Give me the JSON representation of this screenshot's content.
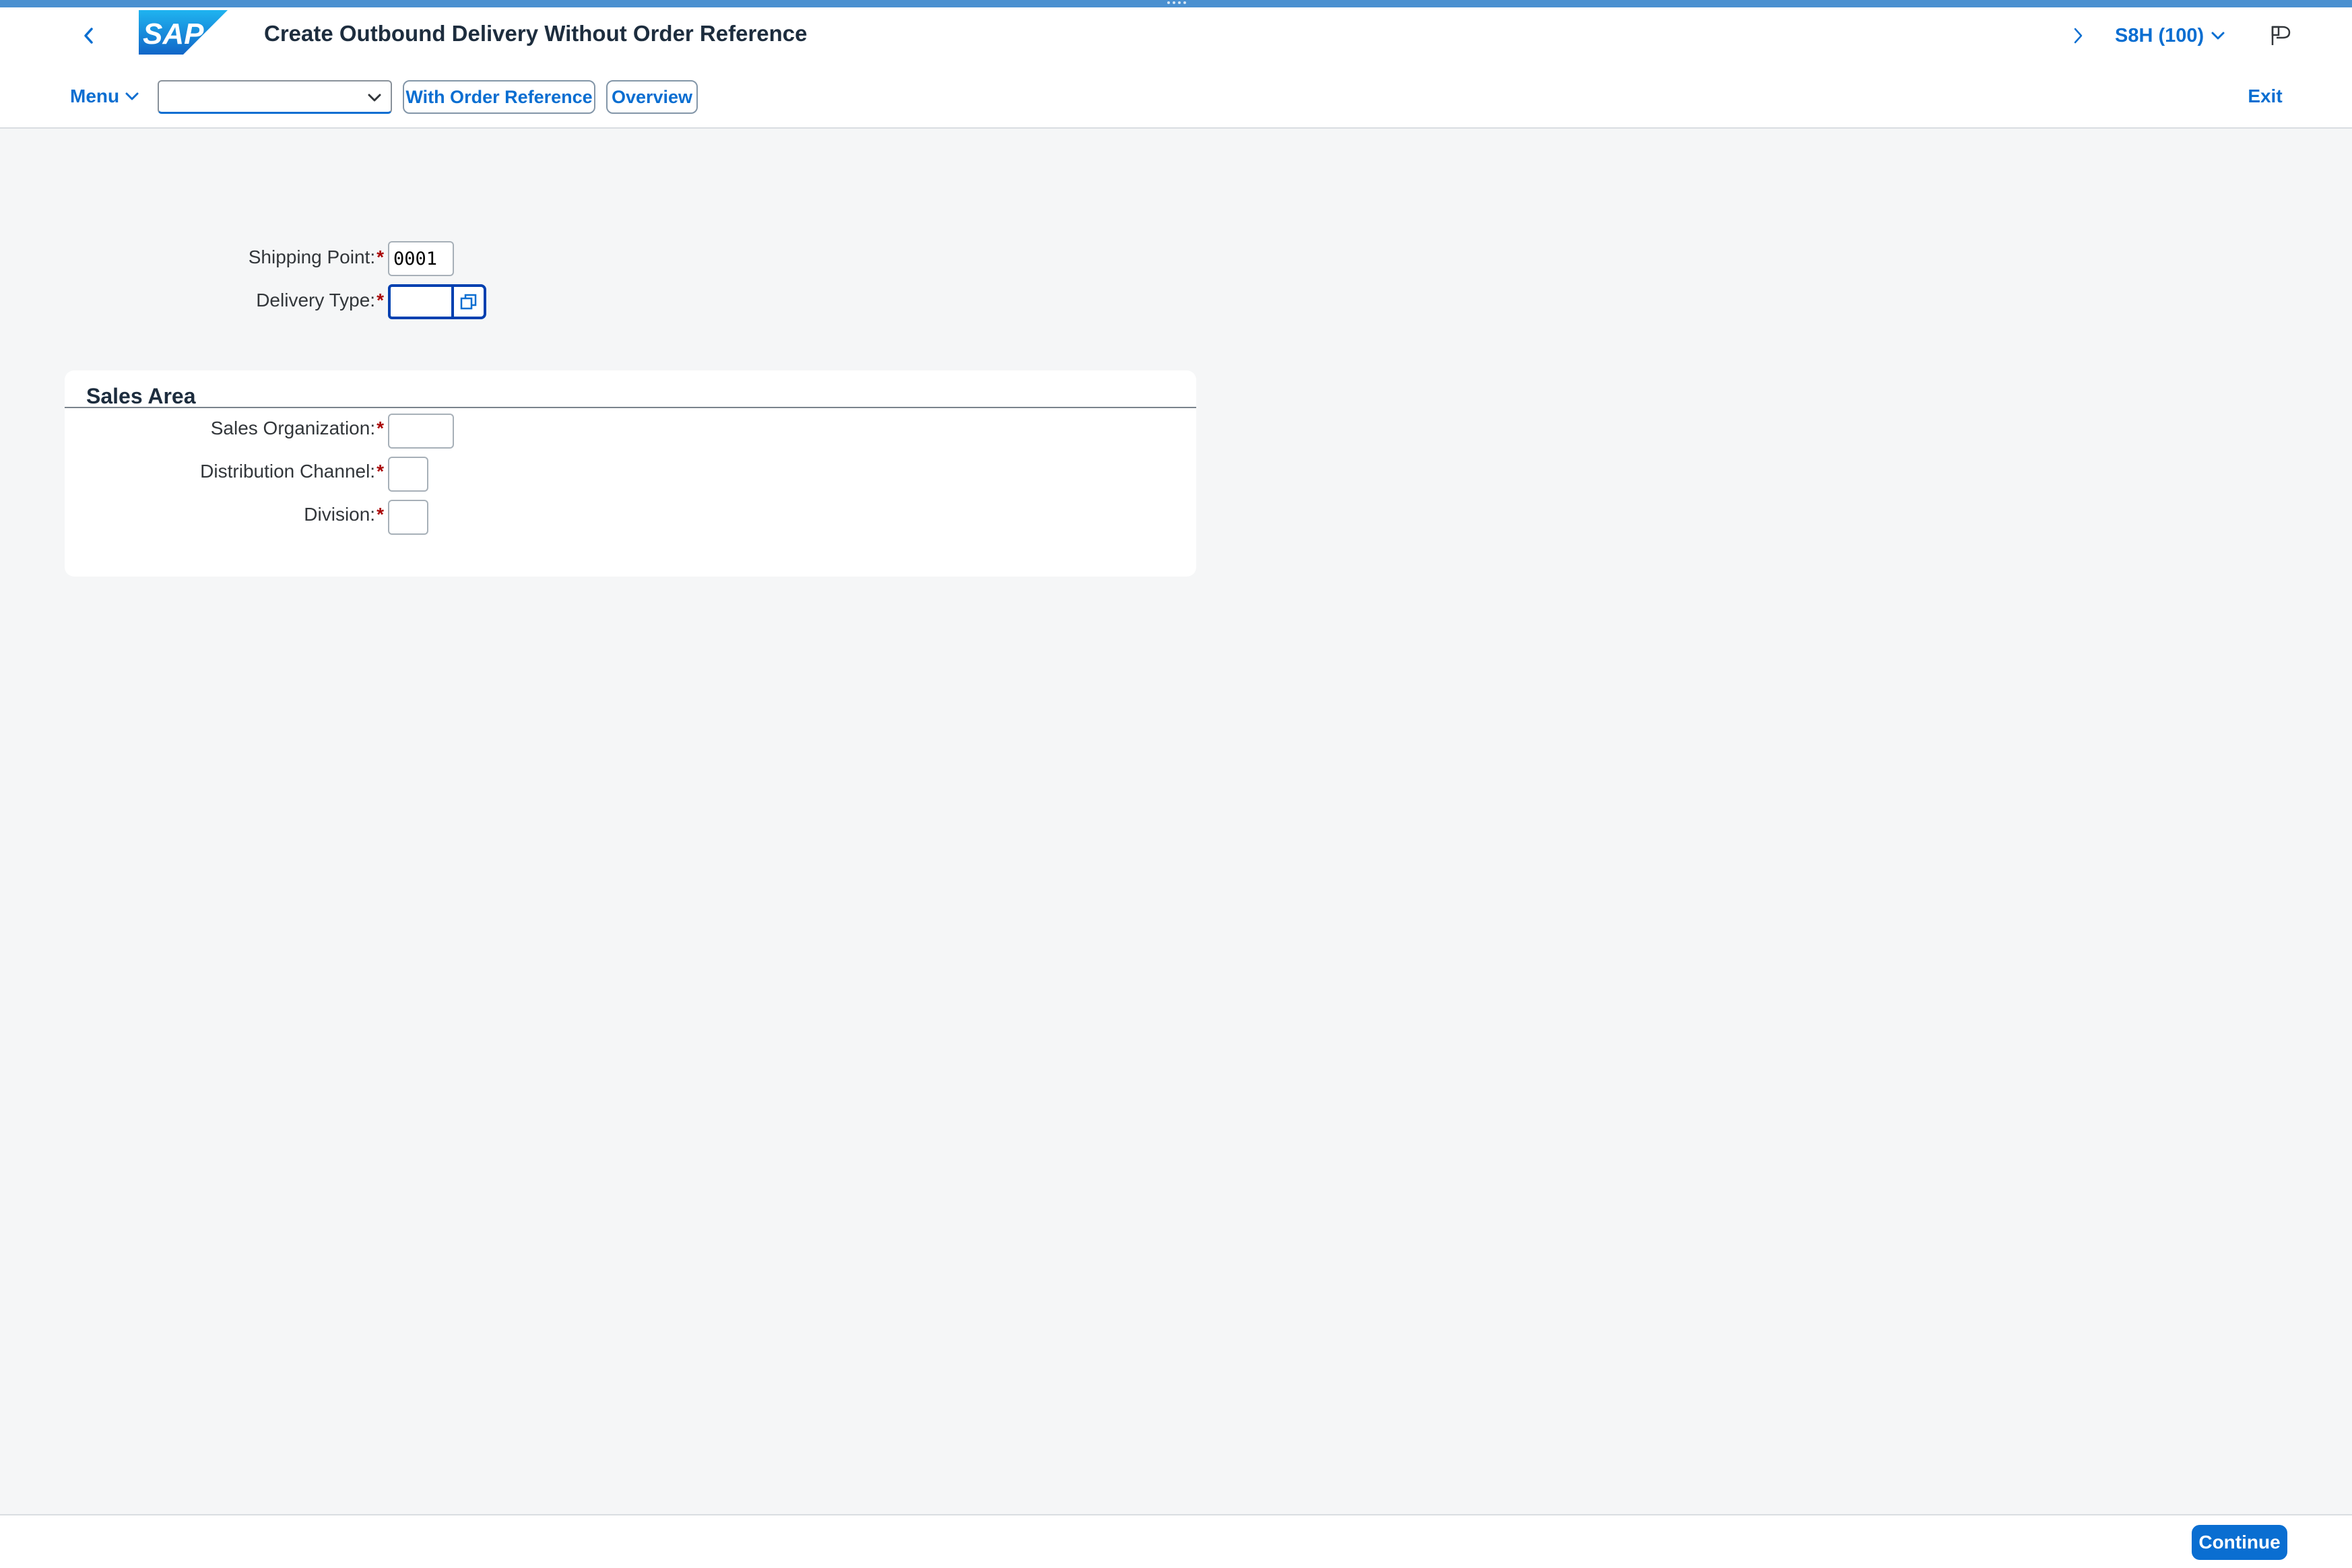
{
  "shell": {
    "title": "Create Outbound Delivery Without Order Reference",
    "system": "S8H (100)",
    "logo_text": "SAP"
  },
  "toolbar": {
    "menu_label": "Menu",
    "command_value": "",
    "with_order_reference_label": "With Order Reference",
    "overview_label": "Overview",
    "exit_label": "Exit"
  },
  "form": {
    "shipping_point": {
      "label": "Shipping Point:",
      "required": "*",
      "value": "0001"
    },
    "delivery_type": {
      "label": "Delivery Type:",
      "required": "*",
      "value": ""
    }
  },
  "sales_area": {
    "title": "Sales Area",
    "sales_organization": {
      "label": "Sales Organization:",
      "required": "*",
      "value": ""
    },
    "distribution_channel": {
      "label": "Distribution Channel:",
      "required": "*",
      "value": ""
    },
    "division": {
      "label": "Division:",
      "required": "*",
      "value": ""
    }
  },
  "footer": {
    "continue_label": "Continue"
  },
  "colors": {
    "accent": "#0a6ed1",
    "header_accent": "#4a90d0",
    "required": "#aa0808",
    "focus": "#0040b0",
    "background": "#f5f6f7"
  }
}
